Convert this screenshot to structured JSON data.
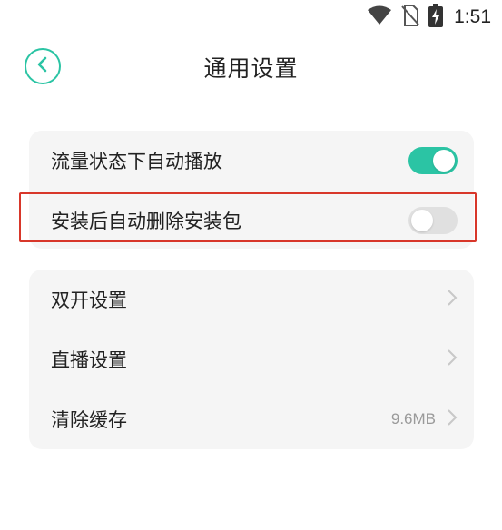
{
  "status_bar": {
    "time": "1:51",
    "icons": [
      "wifi-icon",
      "no-sim-icon",
      "battery-charging-icon"
    ]
  },
  "header": {
    "title": "通用设置",
    "back_icon": "chevron-left-icon"
  },
  "colors": {
    "accent": "#2bc4a4",
    "highlight": "#d8372a",
    "card_bg": "#f5f5f5"
  },
  "section1": {
    "items": [
      {
        "label": "流量状态下自动播放",
        "toggle": "on"
      },
      {
        "label": "安装后自动删除安装包",
        "toggle": "off",
        "highlighted": true
      }
    ]
  },
  "section2": {
    "items": [
      {
        "label": "双开设置",
        "value": ""
      },
      {
        "label": "直播设置",
        "value": ""
      },
      {
        "label": "清除缓存",
        "value": "9.6MB"
      }
    ]
  }
}
